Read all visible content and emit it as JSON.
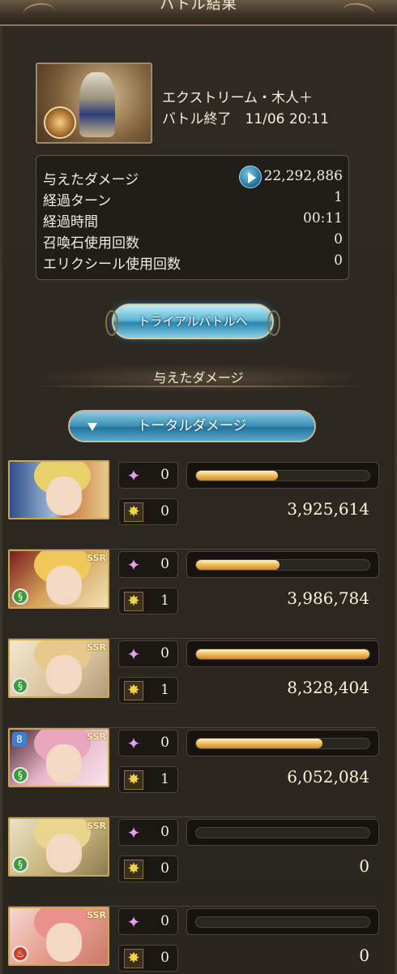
{
  "header": {
    "title": "バトル結果"
  },
  "quest": {
    "name": "エクストリーム・木人＋",
    "status_time": "バトル終了　11/06 20:11"
  },
  "stats": [
    {
      "label": "与えたダメージ",
      "value": "22,292,886"
    },
    {
      "label": "経過ターン",
      "value": "1"
    },
    {
      "label": "経過時間",
      "value": "00:11"
    },
    {
      "label": "召喚石使用回数",
      "value": "0"
    },
    {
      "label": "エリクシール使用回数",
      "value": "0"
    }
  ],
  "trial_button": {
    "label": "トライアルバトルへ"
  },
  "damage_section": {
    "header": "与えたダメージ",
    "filter_label": "トータルダメージ"
  },
  "characters": [
    {
      "special": "0",
      "skill": "0",
      "damage": "3,925,614",
      "bar_fraction": 0.47,
      "element": "",
      "ssr": "",
      "ring": ""
    },
    {
      "special": "0",
      "skill": "1",
      "damage": "3,986,784",
      "bar_fraction": 0.48,
      "element": "wind",
      "ssr": "SSR",
      "ring": ""
    },
    {
      "special": "0",
      "skill": "1",
      "damage": "8,328,404",
      "bar_fraction": 1.0,
      "element": "wind",
      "ssr": "SSR",
      "ring": ""
    },
    {
      "special": "0",
      "skill": "1",
      "damage": "6,052,084",
      "bar_fraction": 0.73,
      "element": "wind",
      "ssr": "SSR",
      "ring": "8"
    },
    {
      "special": "0",
      "skill": "0",
      "damage": "0",
      "bar_fraction": 0.0,
      "element": "wind",
      "ssr": "SSR",
      "ring": ""
    },
    {
      "special": "0",
      "skill": "0",
      "damage": "0",
      "bar_fraction": 0.0,
      "element": "fire",
      "ssr": "SSR",
      "ring": ""
    }
  ],
  "colors": {
    "accent": "#2a86ae",
    "bar_fill": "#f2c163",
    "wind": "#3e9b3a",
    "fire": "#c9412b"
  },
  "icons": {
    "special": "charge-sparkle-icon",
    "skill": "skill-burst-icon",
    "element_wind": "wind-element-icon",
    "element_fire": "fire-element-icon"
  }
}
